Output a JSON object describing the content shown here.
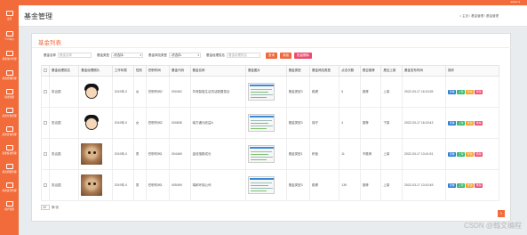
{
  "topbar": {
    "user": "admin ▾"
  },
  "sidebar": {
    "items": [
      {
        "label": "主页",
        "icon": "home-icon"
      },
      {
        "label": "个人中心",
        "icon": "user-icon"
      },
      {
        "label": "基金用户管理",
        "icon": "monitor-icon"
      },
      {
        "label": "基金经理管理",
        "icon": "monitor-icon"
      },
      {
        "label": "基金管理",
        "icon": "monitor-icon"
      },
      {
        "label": "基金分类管理",
        "icon": "monitor-icon"
      },
      {
        "label": "基金咨询管理",
        "icon": "monitor-icon"
      },
      {
        "label": "基金投资管理",
        "icon": "monitor-icon"
      },
      {
        "label": "基金调整管理",
        "icon": "monitor-icon"
      },
      {
        "label": "基金资讯管理",
        "icon": "monitor-icon"
      },
      {
        "label": "用户管理",
        "icon": "monitor-icon"
      }
    ]
  },
  "header": {
    "title": "基金管理",
    "breadcrumb": "⌂ 主页  /  基金管理  /  基金管理"
  },
  "panel": {
    "title": "基金列表"
  },
  "search": {
    "name_label": "基金名称",
    "name_placeholder": "基金名称",
    "type_label": "基金类型",
    "type_value": "-请选择-",
    "risk_label": "基金风险类型",
    "risk_value": "-请选择-",
    "manager_label": "基金经理姓名",
    "manager_placeholder": "基金经理姓名",
    "query_button": "查询",
    "add_button": "添加",
    "batch_delete_button": "批量删除"
  },
  "table": {
    "headers": [
      "",
      "基金经理姓名",
      "基金经理照片",
      "工作年限",
      "性别",
      "任职时间",
      "基金代码",
      "基金名称",
      "基金图片",
      "基金类型",
      "基金风险类型",
      "点击次数",
      "是否推荐",
      "是否上架",
      "基金发布时间",
      "操作"
    ],
    "rows": [
      {
        "manager": "张治国",
        "photo": "boy",
        "years": "2019年-0",
        "gender": "女",
        "tenure": "任职时间2",
        "code": "000452",
        "name": "华商智能生活灵活配置混合",
        "type": "基金类型3",
        "risk": "稳健",
        "clicks": "5",
        "recommend": "推荐",
        "shelf": "上架",
        "time": "2022-03-17 16:15:35"
      },
      {
        "manager": "张治国",
        "photo": "boy",
        "years": "2019年-0",
        "gender": "女",
        "tenure": "任职时间2",
        "code": "000838",
        "name": "南方通元收益A",
        "type": "基金类型3",
        "risk": "保守",
        "clicks": "4",
        "recommend": "推荐",
        "shelf": "下架",
        "time": "2022-03-17 16:15:43"
      },
      {
        "manager": "张治国",
        "photo": "cat",
        "years": "2019年-0",
        "gender": "男",
        "tenure": "任职时间1",
        "code": "004469",
        "name": "金信指数成长",
        "type": "基金类型1",
        "risk": "积极",
        "clicks": "11",
        "recommend": "不推荐",
        "shelf": "上架",
        "time": "2022-03-17 13:41:51"
      },
      {
        "manager": "张治国",
        "photo": "cat",
        "years": "2019年-0",
        "gender": "男",
        "tenure": "任职时间1",
        "code": "005069",
        "name": "瑞和环保公司",
        "type": "基金类型3",
        "risk": "稳健",
        "clicks": "139",
        "recommend": "推荐",
        "shelf": "上架",
        "time": "2022-03-17 13:42:45"
      }
    ],
    "actions": {
      "detail": "查看",
      "up": "上架",
      "edit": "修改",
      "delete": "删除"
    }
  },
  "pager": {
    "page_size": "10",
    "per_page_label": "条/页",
    "current_page": "1"
  },
  "watermark": "CSDN @翰文编程",
  "colors": {
    "accent": "#f26b3a",
    "detail": "#2f7fd1",
    "up": "#33b86b",
    "edit": "#f2a02b",
    "delete": "#ec4c6e"
  }
}
